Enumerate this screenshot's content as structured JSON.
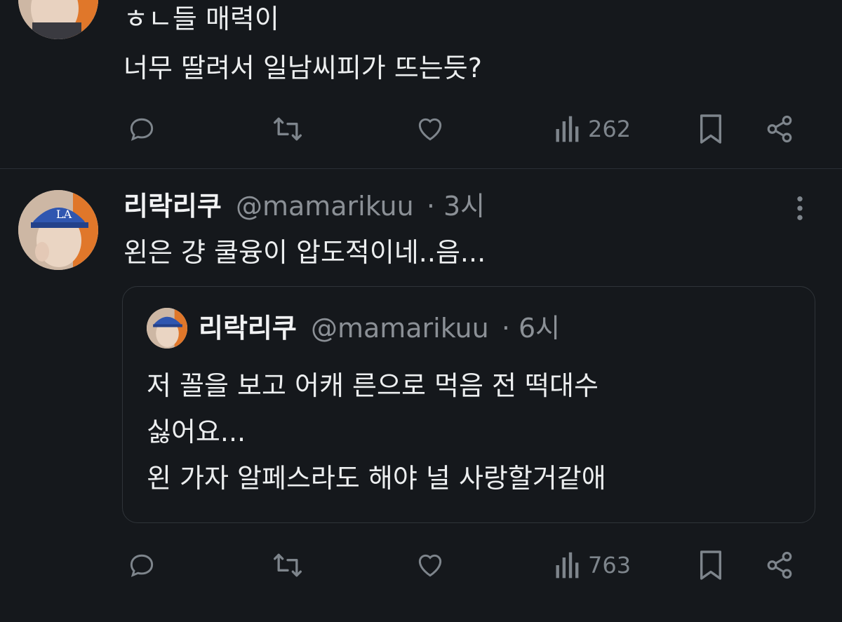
{
  "tweet1": {
    "lines": [
      "ㅎㄴ들 매력이",
      "너무 딸려서 일남씨피가 뜨는듯?"
    ],
    "views": "262"
  },
  "tweet2": {
    "display_name": "리락리쿠",
    "handle": "@mamarikuu",
    "time": "· 3시",
    "text": "왼은 걍 쿨융이 압도적이네..음...",
    "views": "763",
    "quote": {
      "display_name": "리락리쿠",
      "handle": "@mamarikuu",
      "time": "· 6시",
      "lines": [
        "저 꼴을 보고 어캐 른으로 먹음 전 떡대수",
        "싫어요...",
        "왼 가자 알페스라도 해야 널 사랑할거같애"
      ]
    }
  },
  "icons": {
    "reply": "reply-icon",
    "retweet": "retweet-icon",
    "like": "heart-icon",
    "views": "views-icon",
    "bookmark": "bookmark-icon",
    "share": "share-icon",
    "more": "more-vertical-icon"
  },
  "colors": {
    "background": "#15181c",
    "text": "#e7e9ea",
    "muted": "#7e858c"
  }
}
